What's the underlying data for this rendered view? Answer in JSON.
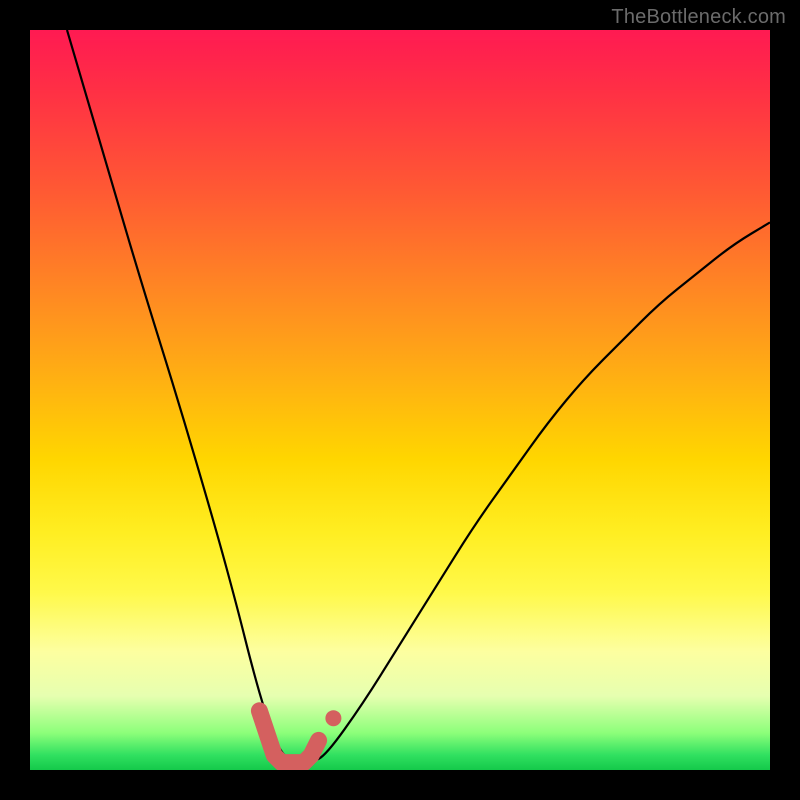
{
  "watermark": {
    "text": "TheBottleneck.com"
  },
  "colors": {
    "curve": "#000000",
    "marker": "#d4605f",
    "marker_fill": "#d4605f"
  },
  "chart_data": {
    "type": "line",
    "title": "",
    "xlabel": "",
    "ylabel": "",
    "xlim": [
      0,
      100
    ],
    "ylim": [
      0,
      100
    ],
    "grid": false,
    "series": [
      {
        "name": "bottleneck-curve",
        "x": [
          5,
          10,
          15,
          20,
          25,
          28,
          30,
          32,
          34,
          36,
          38,
          40,
          45,
          50,
          55,
          60,
          65,
          70,
          75,
          80,
          85,
          90,
          95,
          100
        ],
        "values": [
          100,
          83,
          66,
          50,
          33,
          22,
          14,
          7,
          2,
          1,
          1,
          2,
          9,
          17,
          25,
          33,
          40,
          47,
          53,
          58,
          63,
          67,
          71,
          74
        ]
      }
    ],
    "markers": {
      "name": "highlighted-range",
      "style": "thick-rounded",
      "color": "#d4605f",
      "x": [
        31,
        32,
        33,
        34,
        35,
        36,
        37,
        38,
        39
      ],
      "values": [
        8,
        5,
        2,
        1,
        1,
        1,
        1,
        2,
        4
      ],
      "extra_dot": {
        "x": 41,
        "value": 7
      }
    }
  }
}
